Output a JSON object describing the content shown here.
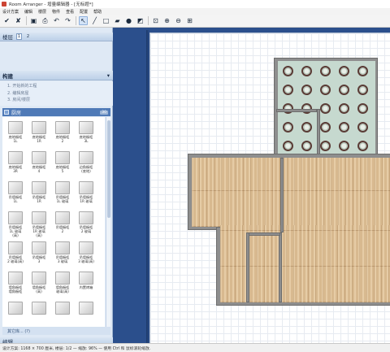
{
  "window": {
    "title": "Room Arranger - 增量编辑器 - [无标题*]"
  },
  "menu": [
    "设计方案",
    "编辑",
    "楼层",
    "物件",
    "查看",
    "配置",
    "帮助"
  ],
  "toolbar": [
    {
      "icon": "check-icon",
      "glyph": "✔"
    },
    {
      "icon": "cross-icon",
      "glyph": "✘"
    },
    {
      "icon": "save-icon",
      "glyph": "▣"
    },
    {
      "icon": "print-icon",
      "glyph": "⎙"
    },
    {
      "icon": "undo-icon",
      "glyph": "↶"
    },
    {
      "icon": "redo-icon",
      "glyph": "↷"
    },
    {
      "icon": "pointer-icon",
      "glyph": "↖"
    },
    {
      "icon": "line-icon",
      "glyph": "╱"
    },
    {
      "icon": "rectangle-icon",
      "glyph": "□"
    },
    {
      "icon": "wall-icon",
      "glyph": "▰"
    },
    {
      "icon": "fill-icon",
      "glyph": "●"
    },
    {
      "icon": "dimension-icon",
      "glyph": "◩"
    },
    {
      "icon": "zoom-fit-icon",
      "glyph": "⊡"
    },
    {
      "icon": "zoom-in-icon",
      "glyph": "⊕"
    },
    {
      "icon": "zoom-out-icon",
      "glyph": "⊖"
    },
    {
      "icon": "grid-icon",
      "glyph": "⊞"
    }
  ],
  "sidebar": {
    "floors_label": "楼层",
    "floor_tabs": [
      "1",
      "2"
    ],
    "build_label": "构建",
    "steps": [
      "1. 开始新的工程",
      "2. 编辑房屋",
      "3. 房间/楼层"
    ],
    "kitchen_label": "厨房",
    "kitchen_count": "30",
    "items": [
      "底地橱柜\n1L",
      "底地橱柜\n1R",
      "底地橱柜\n2",
      "底地橱柜\n3L",
      "底地橱柜\n3R",
      "底地橱柜\n4",
      "底地橱柜\n5",
      "边角橱柜\n(底地)",
      "吊墙橱柜\n1L",
      "吊墙橱柜\n1R",
      "吊墙橱柜\n1L 玻璃",
      "吊墙橱柜\n1R 玻璃",
      "吊墙橱柜\n1L 玻璃\n(高)",
      "吊墙橱柜\n1R 玻璃\n(高)",
      "吊墙橱柜\n2",
      "吊墙橱柜\n2 玻璃",
      "吊墙橱柜\n2 玻璃(高)",
      "吊墙橱柜\n3",
      "吊墙橱柜\n3 玻璃",
      "吊墙橱柜\n3 玻璃(高)",
      "墙角橱柜\n墙角橱柜",
      "墙角橱柜\n(高)",
      "墙角橱柜\n玻璃(高)",
      "内置烤箱\n",
      "",
      "",
      "",
      ""
    ],
    "more_label": "其它库... (?)",
    "edit_label": "编辑"
  },
  "status": {
    "text": "设计方案: 1168 × 700 厘米, 楼层: 1/2 — 缩放: 96% — 使用 Ctrl 和 鼠标滚轮缩放."
  },
  "colors": {
    "accent": "#4f7ab7",
    "canvas_bg": "#2b4f8c",
    "wood": "#d8b98f",
    "tile": "#c6d9cf",
    "wall": "#8e8e8e"
  }
}
